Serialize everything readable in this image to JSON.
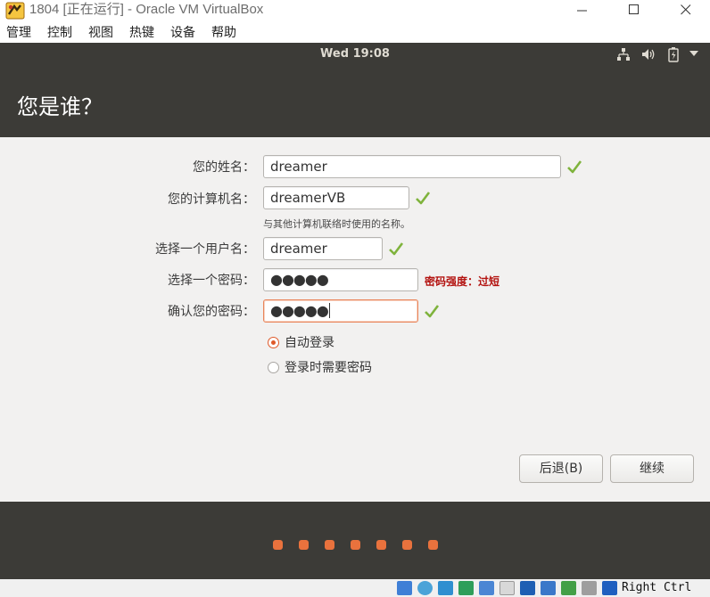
{
  "window": {
    "title": "1804 [正在运行] - Oracle VM VirtualBox"
  },
  "menubar": {
    "items": [
      "管理",
      "控制",
      "视图",
      "热键",
      "设备",
      "帮助"
    ]
  },
  "topbar": {
    "clock": "Wed 19:08",
    "tray_icons": [
      "network-icon",
      "volume-icon",
      "battery-icon",
      "power-menu-arrow-icon"
    ]
  },
  "header": {
    "title": "您是谁？"
  },
  "form": {
    "name_label": "您的姓名：",
    "name_value": "dreamer",
    "computer_label": "您的计算机名：",
    "computer_value": "dreamerVB",
    "computer_hint": "与其他计算机联络时使用的名称。",
    "username_label": "选择一个用户名：",
    "username_value": "dreamer",
    "password_label": "选择一个密码：",
    "password_value": "●●●●●",
    "password_strength": "密码强度：过短",
    "confirm_label": "确认您的密码：",
    "confirm_value": "●●●●●"
  },
  "login": {
    "auto_login": "自动登录",
    "require_password": "登录时需要密码",
    "selected": "auto_login"
  },
  "buttons": {
    "back": "后退(B)",
    "continue": "继续"
  },
  "progress": {
    "total_steps": 7
  },
  "statusbar": {
    "host_key": "Right Ctrl"
  },
  "colors": {
    "ubuntu_dark": "#3c3b37",
    "ubuntu_orange": "#e9723d",
    "check_green": "#7fb33c",
    "strength_red": "#b3120f"
  }
}
